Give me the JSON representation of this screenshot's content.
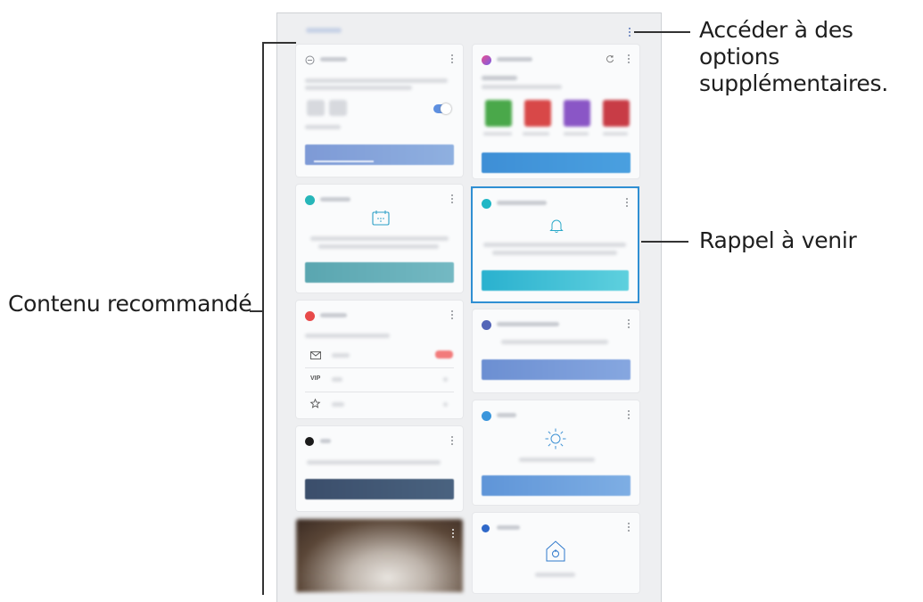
{
  "labels": {
    "more_options": "Accéder à des options supplémentaires.",
    "more_options_line1": "Accéder à des options",
    "more_options_line2": "supplémentaires.",
    "upcoming_reminder": "Rappel à venir",
    "recommended_content": "Contenu recommandé"
  },
  "colors": {
    "callout_line": "#333333",
    "highlight_border": "#2f8fd3",
    "frame_background": "#eeeff1"
  },
  "icons": {
    "more_options": "kebab-menu-icon",
    "calendar": "calendar-icon",
    "bell": "bell-icon",
    "mail": "mail-icon",
    "vip": "vip-label",
    "star": "star-icon",
    "sun": "sun-icon",
    "home": "home-icon",
    "refresh": "refresh-icon"
  },
  "vip_text": "VIP"
}
